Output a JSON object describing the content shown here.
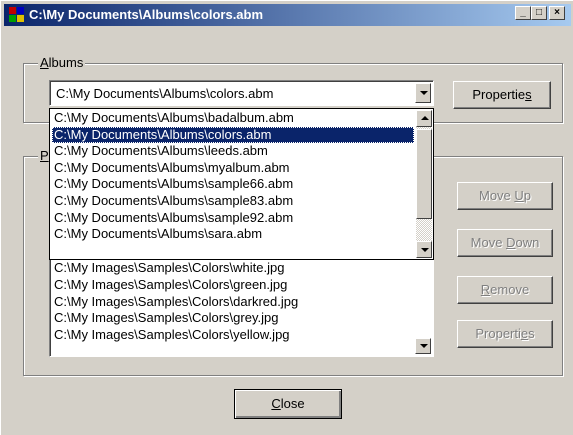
{
  "window": {
    "title": "C:\\My Documents\\Albums\\colors.abm",
    "minimize_glyph": "_",
    "maximize_glyph": "□",
    "close_glyph": "×"
  },
  "albums_group": {
    "label_mnemonic": "A",
    "label_rest": "lbums",
    "combo_value": "C:\\My Documents\\Albums\\colors.abm",
    "properties_label_pre": "Propertie",
    "properties_label_mnemonic": "s"
  },
  "album_dropdown": {
    "items": [
      "C:\\My Documents\\Albums\\badalbum.abm",
      "C:\\My Documents\\Albums\\colors.abm",
      "C:\\My Documents\\Albums\\leeds.abm",
      "C:\\My Documents\\Albums\\myalbum.abm",
      "C:\\My Documents\\Albums\\sample66.abm",
      "C:\\My Documents\\Albums\\sample83.abm",
      "C:\\My Documents\\Albums\\sample92.abm",
      "C:\\My Documents\\Albums\\sara.abm"
    ],
    "selected_index": 1
  },
  "photos_group": {
    "label_mnemonic": "P",
    "files": [
      "C:\\My Images\\Samples\\Colors\\white.jpg",
      "C:\\My Images\\Samples\\Colors\\green.jpg",
      "C:\\My Images\\Samples\\Colors\\darkred.jpg",
      "C:\\My Images\\Samples\\Colors\\grey.jpg",
      "C:\\My Images\\Samples\\Colors\\yellow.jpg"
    ],
    "buttons": {
      "move_up_pre": "Move ",
      "move_up_mnemonic": "U",
      "move_up_post": "p",
      "move_down_pre": "Move ",
      "move_down_mnemonic": "D",
      "move_down_post": "own",
      "remove_mnemonic": "R",
      "remove_post": "emove",
      "properties_pre": "Properti",
      "properties_mnemonic": "e",
      "properties_post": "s"
    }
  },
  "footer": {
    "close_mnemonic": "C",
    "close_post": "lose"
  },
  "colors": {
    "title_bar_start": "#0a246a",
    "title_bar_end": "#a6caf0",
    "selection": "#0a246a",
    "face": "#d4d0c8"
  }
}
